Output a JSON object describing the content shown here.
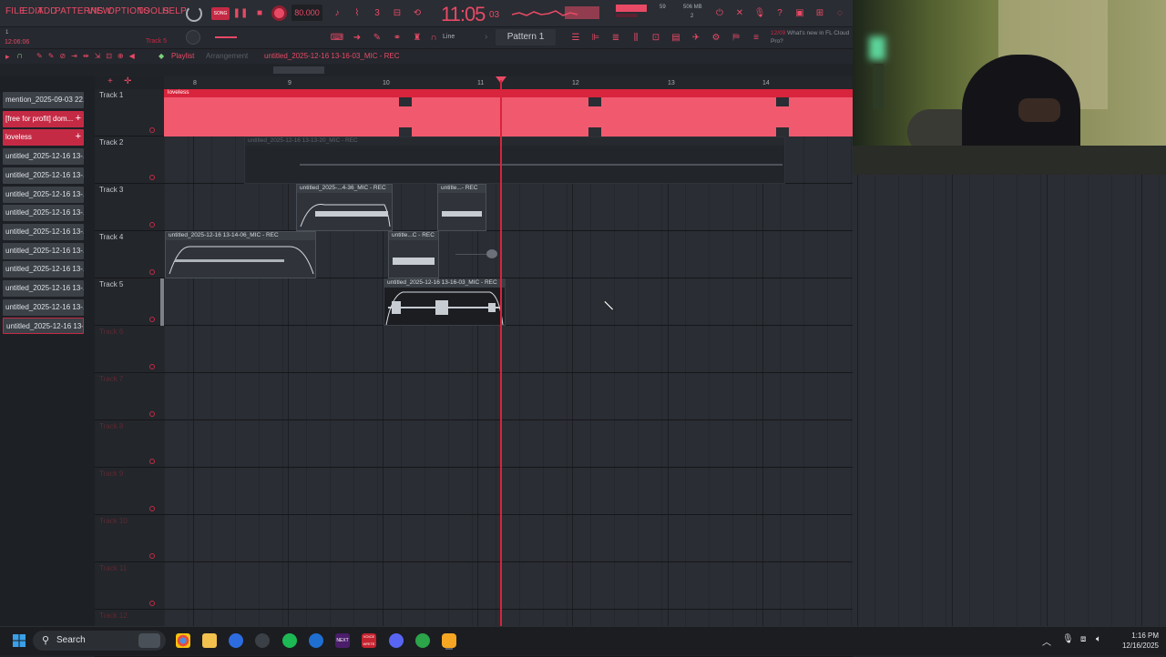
{
  "menu": [
    "FILE",
    "EDIT",
    "ADD",
    "PATTERNS",
    "VIEW",
    "OPTIONS",
    "TOOLS",
    "HELP"
  ],
  "transport": {
    "tempo": "80.000",
    "time": "11:05",
    "time_sub": "03",
    "memory": "506 MB",
    "cpu_count": "2",
    "cpu_val": "59"
  },
  "hint": {
    "date": "12/09",
    "text": "What's new in FL Cloud Pro?"
  },
  "status": {
    "elapsed": "12:06:06",
    "track_hint": "Track 5"
  },
  "snap": "Line",
  "pattern": "Pattern 1",
  "playlist": {
    "title": "Playlist",
    "sub": "Arrangement",
    "clip_title": "untitled_2025-12-16 13-16-03_MIC - REC"
  },
  "ruler": [
    "8",
    "9",
    "10",
    "11",
    "12",
    "13",
    "14"
  ],
  "browser_clips": [
    "mention_2025-09-03 22...",
    "[free for profit] dom...",
    "loveless",
    "untitled_2025-12-16 13-...",
    "untitled_2025-12-16 13-...",
    "untitled_2025-12-16 13-...",
    "untitled_2025-12-16 13-...",
    "untitled_2025-12-16 13-...",
    "untitled_2025-12-16 13-...",
    "untitled_2025-12-16 13-...",
    "untitled_2025-12-16 13-...",
    "untitled_2025-12-16 13-...",
    "untitled_2025-12-16 13-..."
  ],
  "tracks": [
    "Track 1",
    "Track 2",
    "Track 3",
    "Track 4",
    "Track 5",
    "Track 6",
    "Track 7",
    "Track 8",
    "Track 9",
    "Track 10",
    "Track 11",
    "Track 12"
  ],
  "clips": {
    "t1": "loveless",
    "t2": "untitled_2025-12-16 13-13-20_MIC - REC",
    "t3a": "untitled_2025-...4-36_MIC - REC",
    "t3b": "untitle...- REC",
    "t4a": "untitled_2025-12-16 13-14-06_MIC - REC",
    "t4b": "untitle...C - REC",
    "t5": "untitled_2025-12-16 13-16-03_MIC - REC"
  },
  "taskbar": {
    "search": "Search",
    "time": "1:16 PM",
    "date": "12/16/2025"
  },
  "colors": {
    "accent": "#e84a66",
    "red_track": "#f15a6e",
    "playhead": "#d8243c"
  }
}
